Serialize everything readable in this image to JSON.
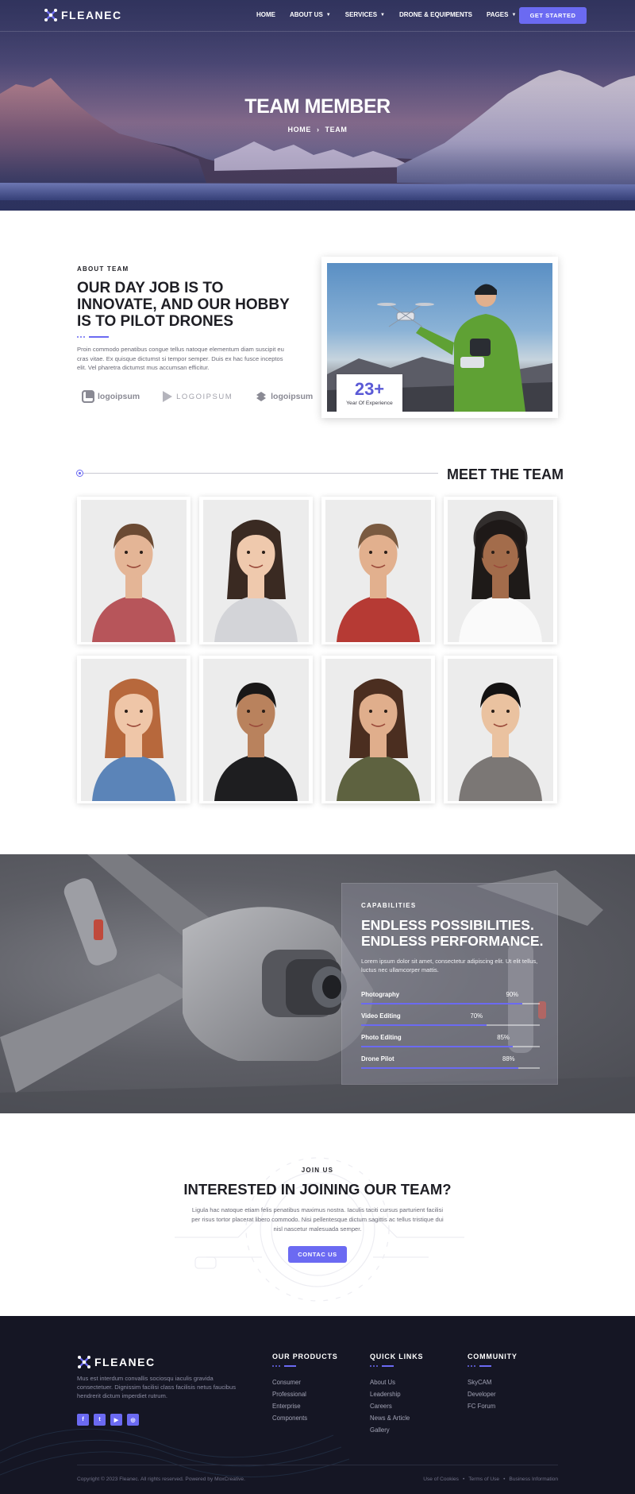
{
  "brand": {
    "name": "FLEANEC",
    "accent": "#6b6af2",
    "dark": "#151624"
  },
  "nav": {
    "items": [
      {
        "label": "HOME",
        "dropdown": false
      },
      {
        "label": "ABOUT US",
        "dropdown": true
      },
      {
        "label": "SERVICES",
        "dropdown": true
      },
      {
        "label": "DRONE & EQUIPMENTS",
        "dropdown": false
      },
      {
        "label": "PAGES",
        "dropdown": true
      }
    ],
    "cta": "GET STARTED"
  },
  "hero": {
    "title": "TEAM MEMBER",
    "breadcrumb": {
      "home": "HOME",
      "separator": "›",
      "current": "TEAM"
    }
  },
  "about": {
    "eyebrow": "ABOUT TEAM",
    "title": "OUR DAY JOB IS TO INNOVATE, AND OUR HOBBY IS TO PILOT DRONES",
    "text": "Proin commodo penatibus congue tellus natoque elementum diam suscipit eu cras vitae. Ex quisque dictumst si tempor semper. Duis ex hac fusce inceptos elit. Vel pharetra dictumst mus accumsan efficitur.",
    "logos": [
      "logoipsum",
      "LOGOIPSUM",
      "logoipsum"
    ],
    "experience": {
      "number": "23+",
      "label": "Year Of Experience"
    }
  },
  "team": {
    "title": "MEET THE TEAM",
    "members": [
      {
        "shirt": "#b7555a",
        "hair": "#6b4a33",
        "skin": "#e4b596"
      },
      {
        "shirt": "#d3d4d8",
        "hair": "#3a2a22",
        "skin": "#efc9ad"
      },
      {
        "shirt": "#b63a34",
        "hair": "#7a5a40",
        "skin": "#e2b08e"
      },
      {
        "shirt": "#fafafa",
        "hair": "#1e1a18",
        "skin": "#a36c4b"
      },
      {
        "shirt": "#5b84b8",
        "hair": "#b7683c",
        "skin": "#efc6a8"
      },
      {
        "shirt": "#1e1e20",
        "hair": "#191717",
        "skin": "#b9825d"
      },
      {
        "shirt": "#5e6240",
        "hair": "#4b2e20",
        "skin": "#e0ae8c"
      },
      {
        "shirt": "#7b7775",
        "hair": "#141212",
        "skin": "#eac2a0"
      }
    ]
  },
  "capabilities": {
    "eyebrow": "CAPABILITIES",
    "title": "ENDLESS POSSIBILITIES. ENDLESS PERFORMANCE.",
    "text": "Lorem ipsum dolor sit amet, consectetur adipiscing elit. Ut elit tellus, luctus nec ullamcorper mattis.",
    "skills": [
      {
        "name": "Photography",
        "percent": 90,
        "label": "90%"
      },
      {
        "name": "Video Editing",
        "percent": 70,
        "label": "70%"
      },
      {
        "name": "Photo Editing",
        "percent": 85,
        "label": "85%"
      },
      {
        "name": "Drone Pilot",
        "percent": 88,
        "label": "88%"
      }
    ]
  },
  "join": {
    "eyebrow": "JOIN US",
    "title": "INTERESTED IN JOINING OUR TEAM?",
    "text": "Ligula hac natoque etiam felis penatibus maximus nostra. Iaculis taciti cursus parturient facilisi per risus tortor placerat libero commodo. Nisi pellentesque dictum sagittis ac tellus tristique dui nisl nascetur malesuada semper.",
    "cta": "CONTAC US"
  },
  "footer": {
    "about": "Mus est interdum convallis sociosqu iaculis gravida consectetuer. Dignissim facilisi class facilisis netus faucibus hendrerit dictum imperdiet rutrum.",
    "socials": [
      {
        "icon": "facebook-icon",
        "glyph": "f"
      },
      {
        "icon": "twitter-icon",
        "glyph": "t"
      },
      {
        "icon": "youtube-icon",
        "glyph": "▶"
      },
      {
        "icon": "instagram-icon",
        "glyph": "◎"
      }
    ],
    "columns": [
      {
        "title": "OUR PRODUCTS",
        "links": [
          "Consumer",
          "Professional",
          "Enterprise",
          "Components"
        ]
      },
      {
        "title": "QUICK LINKS",
        "links": [
          "About Us",
          "Leadership",
          "Careers",
          "News & Article",
          "Gallery"
        ]
      },
      {
        "title": "COMMUNITY",
        "links": [
          "SkyCAM",
          "Developer",
          "FC Forum"
        ]
      }
    ],
    "copyright": "Copyright © 2023 Fleanec. All rights reserved. Powered by MoxCreative.",
    "legal": [
      "Use of Cookies",
      "Terms of Use",
      "Business Information"
    ],
    "legal_sep": "•"
  }
}
